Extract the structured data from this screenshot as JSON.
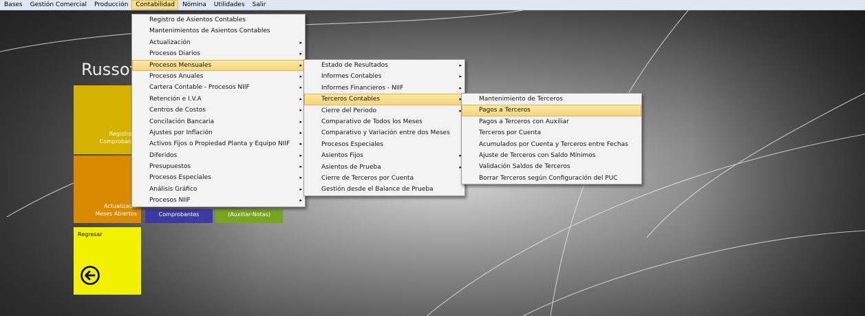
{
  "menubar": [
    {
      "label": "Bases",
      "active": false
    },
    {
      "label": "Gestión Comercial",
      "active": false
    },
    {
      "label": "Producción",
      "active": false
    },
    {
      "label": "Contabilidad",
      "active": true
    },
    {
      "label": "Nómina",
      "active": false
    },
    {
      "label": "Utilidades",
      "active": false
    },
    {
      "label": "Salir",
      "active": false
    }
  ],
  "brand_left": "Russoft",
  "brand_right": ".]",
  "tiles": {
    "registro": {
      "line1": "Registro d",
      "line2": "Comprobante",
      "color": "#d5b100"
    },
    "actualizacion": {
      "line1": "Actualizació",
      "line2": "Meses Abiertos",
      "color": "#d98a00"
    },
    "comprobantes": {
      "label": "Comprobantes",
      "color": "#3d3aa3"
    },
    "auxiliar": {
      "label": "(Auxiliar-Notas)",
      "color": "#78a520"
    },
    "regresar": {
      "label": "Regresar",
      "color": "#f2f200"
    }
  },
  "menu_contabilidad": [
    {
      "label": "Registro de Asientos Contables",
      "sub": false,
      "hl": false
    },
    {
      "label": "Mantenimientos de Asientos Contables",
      "sub": false,
      "hl": false
    },
    {
      "label": "Actualización",
      "sub": true,
      "hl": false
    },
    {
      "label": "Procesos Diarios",
      "sub": true,
      "hl": false
    },
    {
      "label": "Procesos Mensuales",
      "sub": true,
      "hl": true
    },
    {
      "label": "Procesos Anuales",
      "sub": true,
      "hl": false
    },
    {
      "label": "Cartera Contable - Procesos NIIF",
      "sub": true,
      "hl": false
    },
    {
      "label": "Retención e I.V.A",
      "sub": true,
      "hl": false
    },
    {
      "label": "Centros de Costos",
      "sub": true,
      "hl": false
    },
    {
      "label": "Concilación Bancaria",
      "sub": true,
      "hl": false
    },
    {
      "label": "Ajustes por Inflación",
      "sub": true,
      "hl": false
    },
    {
      "label": "Activos Fijos o Propiedad Planta y Equipo NIIF",
      "sub": true,
      "hl": false
    },
    {
      "label": "Diferidos",
      "sub": true,
      "hl": false
    },
    {
      "label": "Presupuestos",
      "sub": true,
      "hl": false
    },
    {
      "label": "Procesos Especiales",
      "sub": true,
      "hl": false
    },
    {
      "label": "Análisis Gráfico",
      "sub": true,
      "hl": false
    },
    {
      "label": "Procesos NIIF",
      "sub": true,
      "hl": false
    }
  ],
  "menu_mensuales": [
    {
      "label": "Estado de Resultados",
      "sub": true,
      "hl": false
    },
    {
      "label": "Informes Contables",
      "sub": true,
      "hl": false
    },
    {
      "label": "Informes Financieros - NIIF",
      "sub": true,
      "hl": false
    },
    {
      "label": "Terceros Contables",
      "sub": true,
      "hl": true
    },
    {
      "label": "Cierre del Periodo",
      "sub": true,
      "hl": false
    },
    {
      "label": "Comparativo de Todos los Meses",
      "sub": false,
      "hl": false
    },
    {
      "label": "Comparativo y Variación entre dos Meses",
      "sub": false,
      "hl": false
    },
    {
      "label": "Procesos Especiales",
      "sub": false,
      "hl": false
    },
    {
      "label": "Asientos Fijos",
      "sub": true,
      "hl": false
    },
    {
      "label": "Asientos de Prueba",
      "sub": true,
      "hl": false
    },
    {
      "label": "Cierre de Terceros por Cuenta",
      "sub": false,
      "hl": false
    },
    {
      "label": "Gestión desde el Balance de Prueba",
      "sub": false,
      "hl": false
    }
  ],
  "menu_terceros": [
    {
      "label": "Mantenimiento de Terceros",
      "sub": false,
      "hl": false
    },
    {
      "label": "Pagos a Terceros",
      "sub": false,
      "hl": true
    },
    {
      "label": "Pagos a Terceros con Auxiliar",
      "sub": false,
      "hl": false
    },
    {
      "label": "Terceros por Cuenta",
      "sub": false,
      "hl": false
    },
    {
      "label": "Acumulados por Cuenta y Terceros entre Fechas",
      "sub": false,
      "hl": false
    },
    {
      "label": "Ajuste de Terceros con Saldo Mínimos",
      "sub": false,
      "hl": false
    },
    {
      "label": "Validación Saldos de Terceros",
      "sub": false,
      "hl": false
    },
    {
      "label": "Borrar Terceros según Configuración del PUC",
      "sub": false,
      "hl": false
    }
  ],
  "icons": {
    "submenu": "chevron-right-icon",
    "back": "back-arrow-icon"
  }
}
